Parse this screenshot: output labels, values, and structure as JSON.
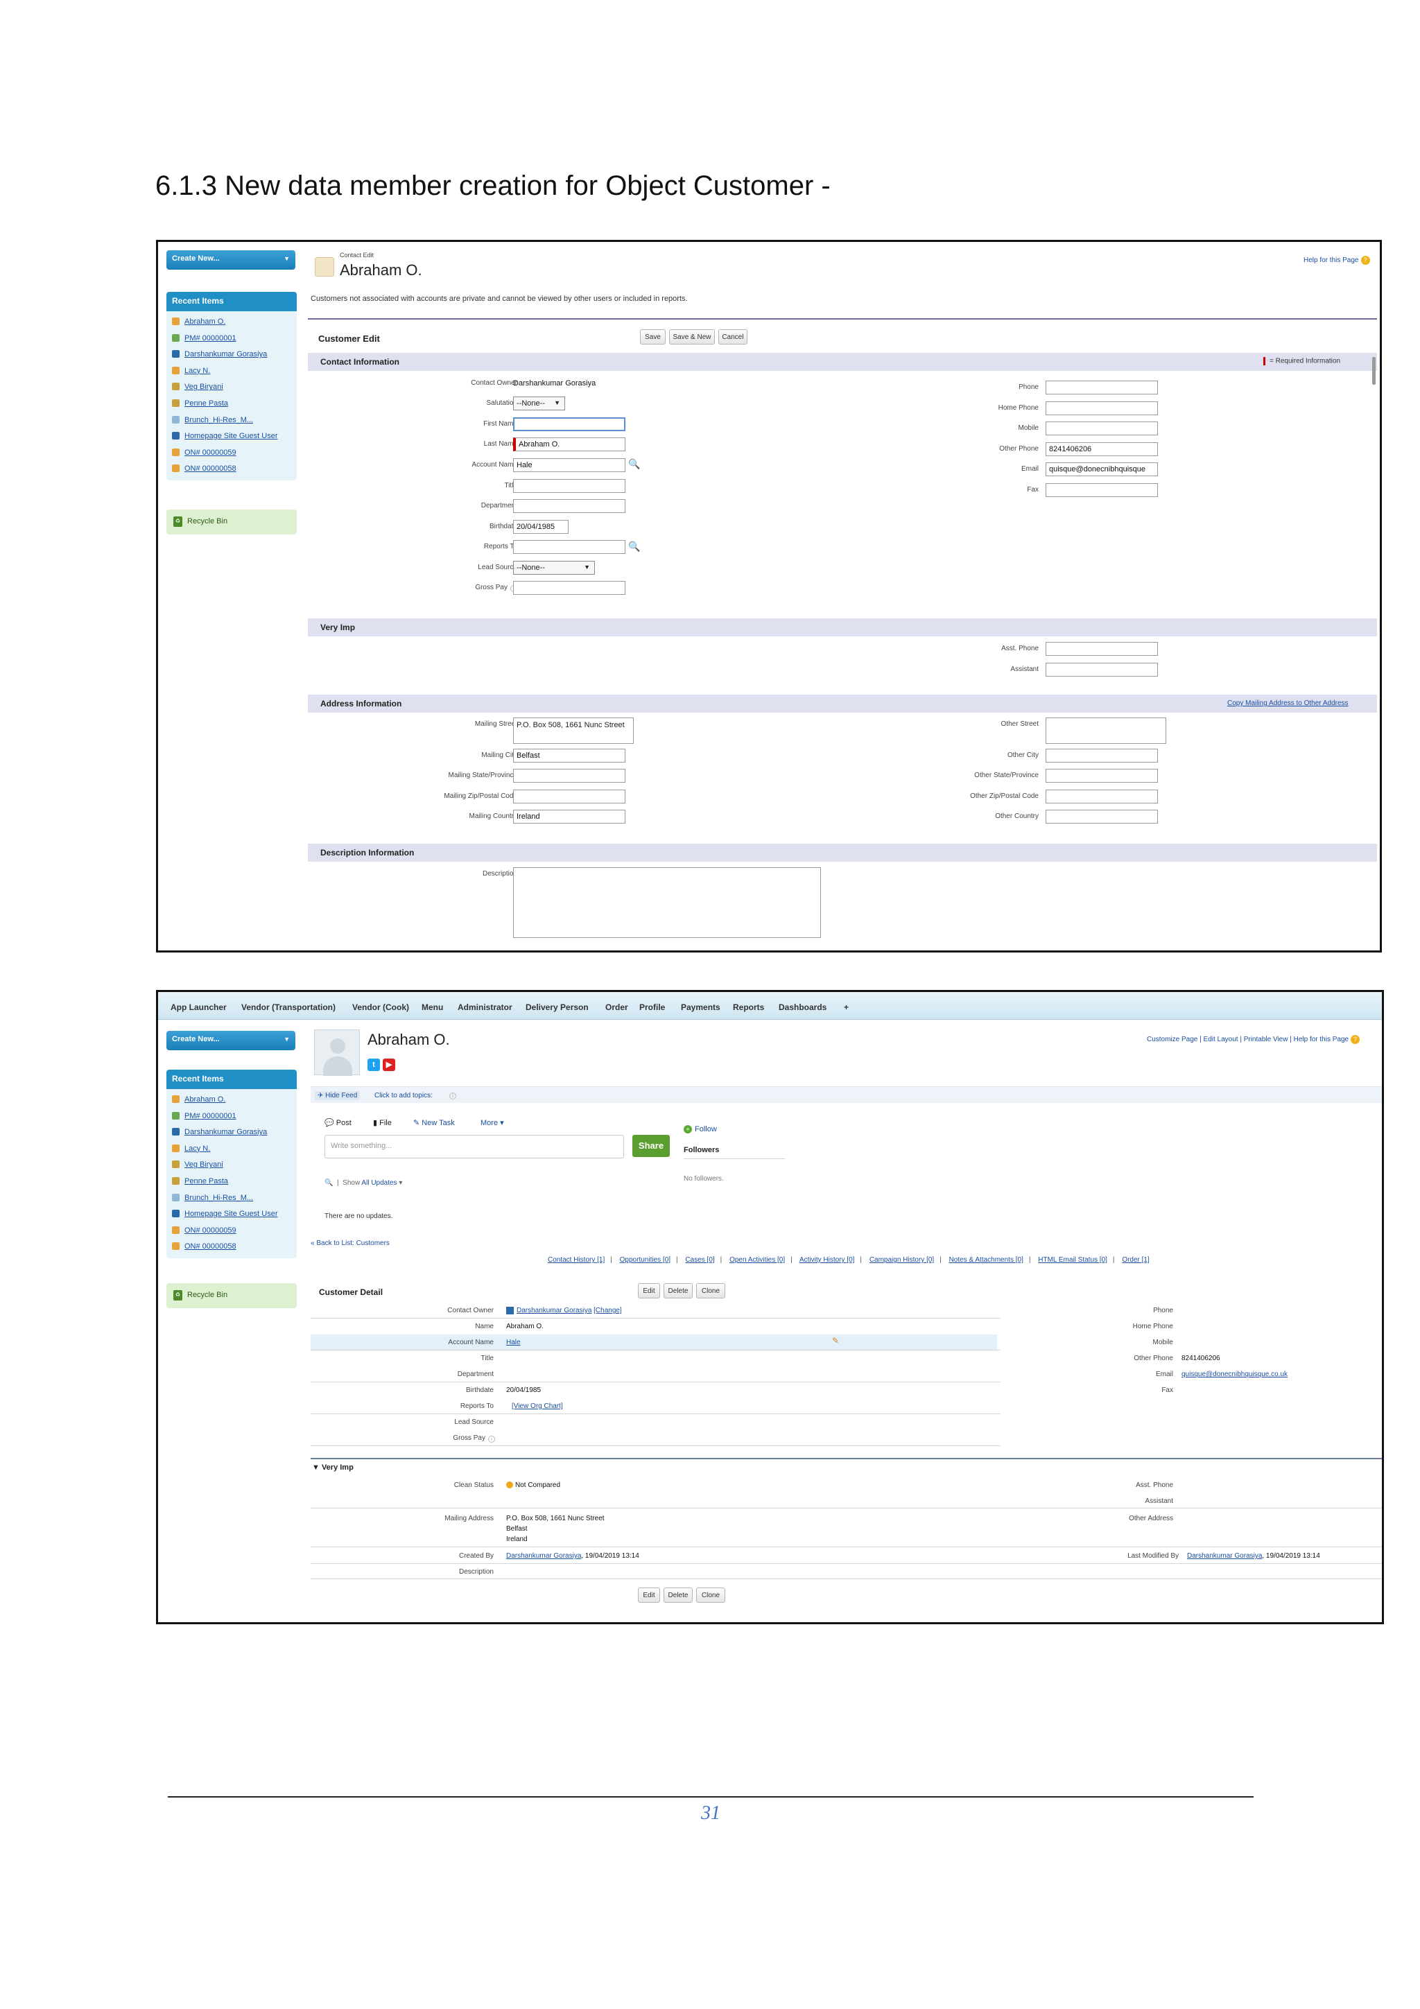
{
  "heading": "6.1.3 New data member creation for Object Customer -",
  "sidebar": {
    "create_new": "Create New...",
    "recent_title": "Recent Items",
    "recent_items": [
      "Abraham O.",
      "PM# 00000001",
      "Darshankumar Gorasiya",
      "Lacy N.",
      "Veg Biryani",
      "Penne Pasta",
      "Brunch_Hi-Res_M...",
      "Homepage Site Guest User",
      "ON# 00000059",
      "ON# 00000058"
    ],
    "recycle_bin": "Recycle Bin"
  },
  "edit_page": {
    "breadcrumb": "Contact Edit",
    "title": "Abraham O.",
    "help_link": "Help for this Page",
    "note": "Customers not associated with accounts are private and cannot be viewed by other users or included in reports.",
    "block_title": "Customer Edit",
    "buttons": {
      "save": "Save",
      "save_new": "Save & New",
      "cancel": "Cancel"
    },
    "sections": {
      "contact": "Contact Information",
      "required": "= Required Information",
      "very_imp": "Very Imp",
      "address": "Address Information",
      "copy_address": "Copy Mailing Address to Other Address",
      "description": "Description Information"
    },
    "left_fields": {
      "contact_owner": {
        "label": "Contact Owner",
        "value": "Darshankumar Gorasiya"
      },
      "salutation": {
        "label": "Salutation",
        "value": "--None--"
      },
      "first_name": {
        "label": "First Name",
        "value": ""
      },
      "last_name": {
        "label": "Last Name",
        "value": "Abraham O."
      },
      "account_name": {
        "label": "Account Name",
        "value": "Hale"
      },
      "title": {
        "label": "Title",
        "value": ""
      },
      "department": {
        "label": "Department",
        "value": ""
      },
      "birthdate": {
        "label": "Birthdate",
        "value": "20/04/1985"
      },
      "reports_to": {
        "label": "Reports To",
        "value": ""
      },
      "lead_source": {
        "label": "Lead Source",
        "value": "--None--"
      },
      "gross_pay": {
        "label": "Gross Pay",
        "value": ""
      }
    },
    "right_fields": {
      "phone": {
        "label": "Phone",
        "value": ""
      },
      "home_phone": {
        "label": "Home Phone",
        "value": ""
      },
      "mobile": {
        "label": "Mobile",
        "value": ""
      },
      "other_phone": {
        "label": "Other Phone",
        "value": "8241406206"
      },
      "email": {
        "label": "Email",
        "value": "quisque@donecnibhquisque"
      },
      "fax": {
        "label": "Fax",
        "value": ""
      }
    },
    "very_imp_fields": {
      "asst_phone": {
        "label": "Asst. Phone",
        "value": ""
      },
      "assistant": {
        "label": "Assistant",
        "value": ""
      }
    },
    "address_fields": {
      "mailing_street": {
        "label": "Mailing Street",
        "value": "P.O. Box 508, 1661 Nunc Street"
      },
      "mailing_city": {
        "label": "Mailing City",
        "value": "Belfast"
      },
      "mailing_state": {
        "label": "Mailing State/Province",
        "value": ""
      },
      "mailing_zip": {
        "label": "Mailing Zip/Postal Code",
        "value": ""
      },
      "mailing_country": {
        "label": "Mailing Country",
        "value": "Ireland"
      },
      "other_street": {
        "label": "Other Street",
        "value": ""
      },
      "other_city": {
        "label": "Other City",
        "value": ""
      },
      "other_state": {
        "label": "Other State/Province",
        "value": ""
      },
      "other_zip": {
        "label": "Other Zip/Postal Code",
        "value": ""
      },
      "other_country": {
        "label": "Other Country",
        "value": ""
      }
    },
    "description": {
      "label": "Description",
      "value": ""
    }
  },
  "detail_page": {
    "app_nav": [
      "App Launcher",
      "Vendor (Transportation)",
      "Vendor (Cook)",
      "Menu",
      "Administrator",
      "Delivery Person",
      "Order",
      "Profile",
      "Payments",
      "Reports",
      "Dashboards",
      "+"
    ],
    "title": "Abraham O.",
    "top_links": "Customize Page | Edit Layout | Printable View | Help for this Page",
    "hide_feed": "Hide Feed",
    "add_topics": "Click to add topics:",
    "feed_actions": {
      "post": "Post",
      "file": "File",
      "new_task": "New Task",
      "more": "More ▾"
    },
    "composer_placeholder": "Write something...",
    "share": "Share",
    "follow": "Follow",
    "followers": "Followers",
    "no_followers": "No followers.",
    "show_updates": "Show",
    "all_updates": "All Updates",
    "no_updates": "There are no updates.",
    "back_link": "« Back to List: Customers",
    "related_links": [
      "Contact History [1]",
      "Opportunities [0]",
      "Cases [0]",
      "Open Activities [0]",
      "Activity History [0]",
      "Campaign History [0]",
      "Notes & Attachments [0]",
      "HTML Email Status [0]",
      "Order [1]"
    ],
    "block_title": "Customer Detail",
    "buttons": {
      "edit": "Edit",
      "delete": "Delete",
      "clone": "Clone"
    },
    "left_fields": [
      {
        "label": "Contact Owner",
        "value": "Darshankumar Gorasiya",
        "extra": "[Change]"
      },
      {
        "label": "Name",
        "value": "Abraham O."
      },
      {
        "label": "Account Name",
        "value": "Hale"
      },
      {
        "label": "Title",
        "value": ""
      },
      {
        "label": "Department",
        "value": ""
      },
      {
        "label": "Birthdate",
        "value": "20/04/1985"
      },
      {
        "label": "Reports To",
        "value": "[View Org Chart]"
      },
      {
        "label": "Lead Source",
        "value": ""
      },
      {
        "label": "Gross Pay",
        "value": ""
      }
    ],
    "right_fields": [
      {
        "label": "Phone",
        "value": ""
      },
      {
        "label": "Home Phone",
        "value": ""
      },
      {
        "label": "Mobile",
        "value": ""
      },
      {
        "label": "Other Phone",
        "value": "8241406206"
      },
      {
        "label": "Email",
        "value": "quisque@donecnibhquisque.co.uk"
      },
      {
        "label": "Fax",
        "value": ""
      }
    ],
    "very_imp": "▼ Very Imp",
    "clean_status": {
      "label": "Clean Status",
      "value": "Not Compared"
    },
    "asst_phone": {
      "label": "Asst. Phone",
      "value": ""
    },
    "assistant": {
      "label": "Assistant",
      "value": ""
    },
    "mailing_address": {
      "label": "Mailing Address",
      "line1": "P.O. Box 508, 1661 Nunc Street",
      "line2": "Belfast",
      "line3": "Ireland"
    },
    "other_address": {
      "label": "Other Address",
      "value": ""
    },
    "created_by": {
      "label": "Created By",
      "value": "Darshankumar Gorasiya",
      "date": ", 19/04/2019 13:14"
    },
    "last_modified_by": {
      "label": "Last Modified By",
      "value": "Darshankumar Gorasiya",
      "date": ", 19/04/2019 13:14"
    },
    "description": {
      "label": "Description",
      "value": ""
    }
  },
  "page_number": "31",
  "colors": {
    "accent_blue": "#1f8fc6",
    "section_bar": "#dfe1f0",
    "link": "#1a4fa0",
    "share_green": "#5a9e2f",
    "page_number": "#4472c4"
  }
}
